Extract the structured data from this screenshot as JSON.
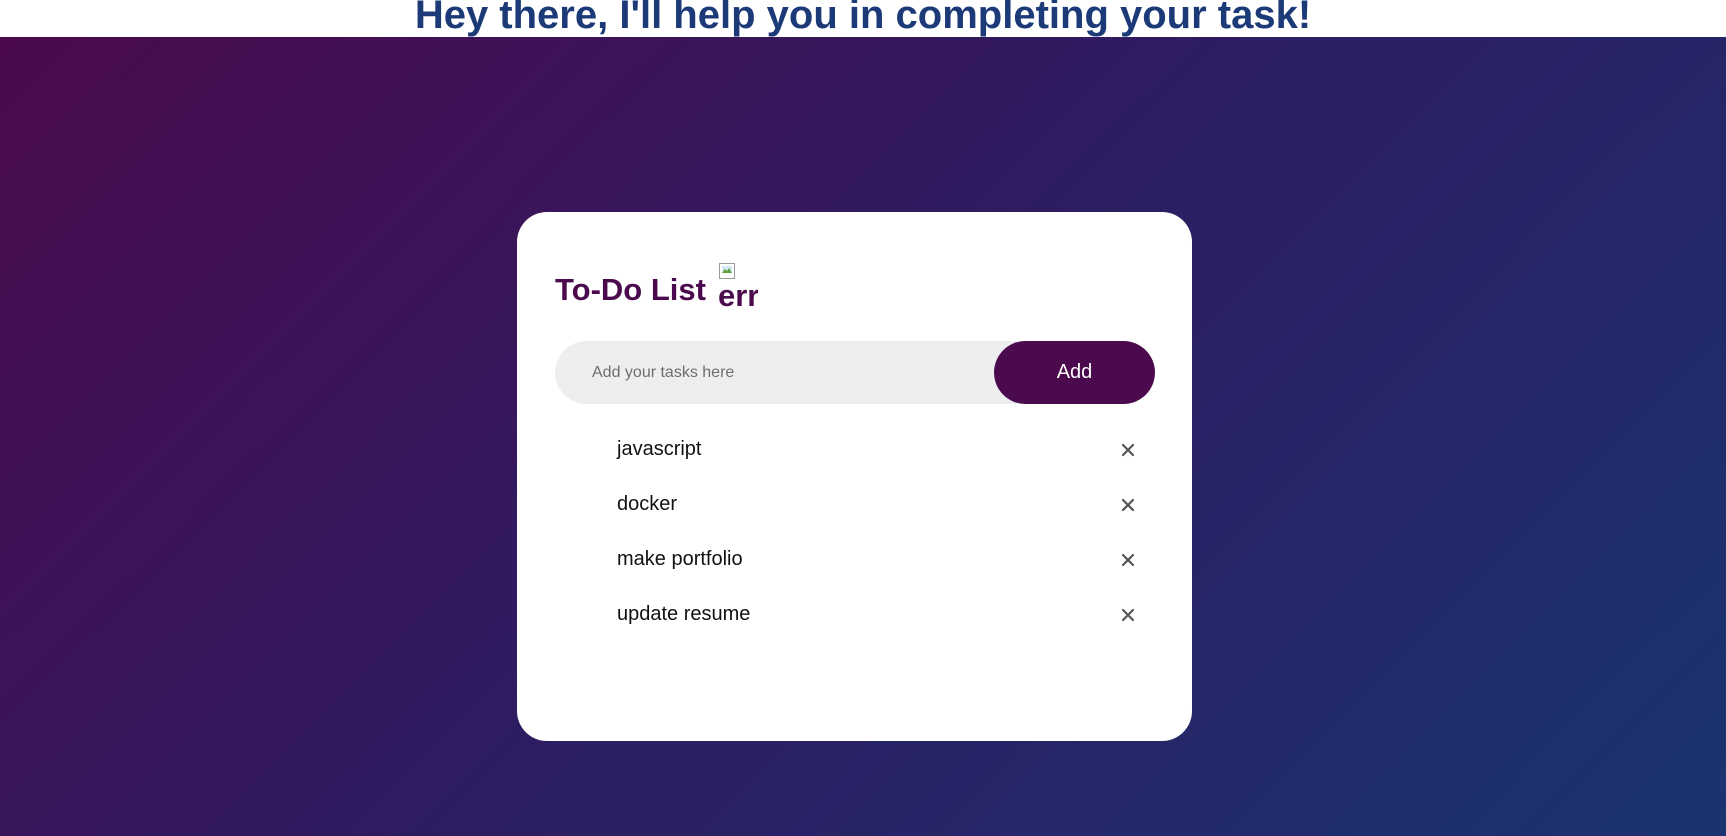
{
  "page": {
    "heading": "Hey there, I'll help you in completing your task!"
  },
  "todo": {
    "title": "To-Do List",
    "image_alt": "err",
    "input_placeholder": "Add your tasks here",
    "input_value": "",
    "add_button_label": "Add",
    "tasks": [
      {
        "text": "javascript",
        "remove_icon": "close-icon"
      },
      {
        "text": "docker",
        "remove_icon": "close-icon"
      },
      {
        "text": "make portfolio",
        "remove_icon": "close-icon"
      },
      {
        "text": "update resume",
        "remove_icon": "close-icon"
      }
    ]
  },
  "colors": {
    "heading": "#1c3a78",
    "brand": "#4b0a4d",
    "gradient_start": "#4b0a4d",
    "gradient_end": "#1a3470",
    "input_background": "#edeef0"
  }
}
